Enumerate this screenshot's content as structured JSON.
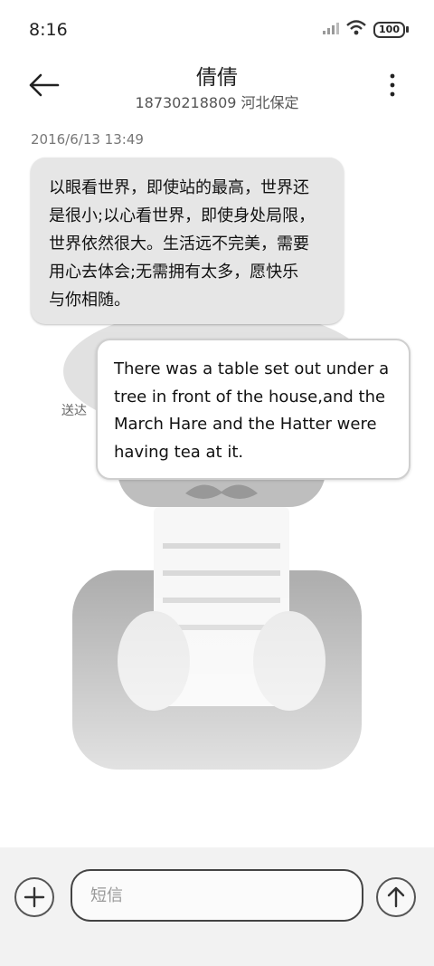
{
  "status_bar": {
    "time": "8:16",
    "battery": "100",
    "icons": [
      "signal-icon",
      "wifi-icon",
      "battery-icon"
    ]
  },
  "header": {
    "title": "倩倩",
    "subtitle": "18730218809 河北保定",
    "back_icon": "back-arrow-icon",
    "more_icon": "more-vertical-icon"
  },
  "conversation": {
    "timestamp": "2016/6/13 13:49",
    "messages": [
      {
        "direction": "incoming",
        "lines": [
          "以眼看世界，即使站的最高，世界还",
          "是很小;以心看世界，即使身处局限，",
          "世界依然很大。生活远不完美，需要",
          "用心去体会;无需拥有太多，愿快乐",
          "与你相随。"
        ]
      },
      {
        "direction": "outgoing",
        "lines": [
          "There was a table set out under a",
          "tree in front of the house,and the",
          "March Hare and the Hatter were",
          "having tea at it."
        ],
        "status": "送达"
      }
    ]
  },
  "composer": {
    "placeholder": "短信",
    "value": "",
    "add_icon": "add-circle-icon",
    "send_icon": "send-arrow-icon"
  },
  "colors": {
    "incoming_bubble": "#e6e6e6",
    "outgoing_bubble": "#ffffff",
    "composer_bg": "#f2f2f2"
  }
}
